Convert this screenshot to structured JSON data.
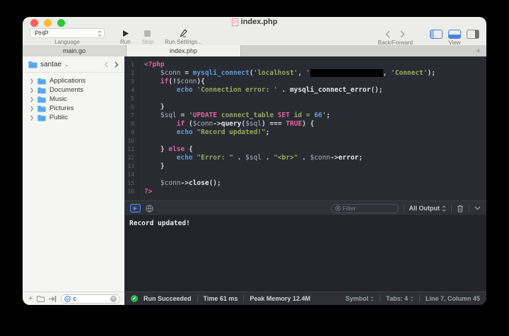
{
  "window": {
    "title": "index.php"
  },
  "toolbar": {
    "language": {
      "value": "PHP",
      "label": "Language"
    },
    "run_label": "Run",
    "stop_label": "Stop",
    "run_settings_label": "Run Settings...",
    "back_forward_label": "Back/Forward",
    "view_label": "View"
  },
  "tabs": {
    "items": [
      {
        "label": "main.go"
      },
      {
        "label": "index.php"
      }
    ],
    "add_label": "+"
  },
  "sidebar": {
    "root_label": "santae",
    "items": [
      {
        "label": "Applications"
      },
      {
        "label": "Documents"
      },
      {
        "label": "Music"
      },
      {
        "label": "Pictures"
      },
      {
        "label": "Public"
      }
    ],
    "footer": {
      "search_value": "c"
    }
  },
  "editor": {
    "lines": [
      {
        "segments": [
          [
            "k",
            "<?php"
          ]
        ]
      },
      {
        "segments": [
          [
            "p",
            "    "
          ],
          [
            "v",
            "$conn"
          ],
          [
            "p",
            " = "
          ],
          [
            "b",
            "mysqli_connect"
          ],
          [
            "p",
            "("
          ],
          [
            "s",
            "'localhost'"
          ],
          [
            "p",
            ", "
          ],
          [
            "s",
            "'"
          ],
          [
            "r",
            "                  "
          ],
          [
            "p",
            ", "
          ],
          [
            "s",
            "'Connect'"
          ],
          [
            "p",
            ");"
          ]
        ]
      },
      {
        "segments": [
          [
            "p",
            "    "
          ],
          [
            "k",
            "if"
          ],
          [
            "p",
            "(!"
          ],
          [
            "v",
            "$conn"
          ],
          [
            "p",
            "){"
          ]
        ]
      },
      {
        "segments": [
          [
            "p",
            "        "
          ],
          [
            "b",
            "echo"
          ],
          [
            "s",
            " 'Connection error: '"
          ],
          [
            "p",
            " . "
          ],
          [
            "w",
            "mysqli_connect_error"
          ],
          [
            "p",
            "();"
          ]
        ]
      },
      {
        "segments": []
      },
      {
        "segments": [
          [
            "p",
            "    }"
          ]
        ]
      },
      {
        "segments": [
          [
            "p",
            "    "
          ],
          [
            "v",
            "$sql"
          ],
          [
            "p",
            " = "
          ],
          [
            "s",
            "'"
          ],
          [
            "k",
            "UPDATE"
          ],
          [
            "s",
            " connect_table "
          ],
          [
            "k",
            "SET"
          ],
          [
            "s",
            " id = "
          ],
          [
            "n",
            "66"
          ],
          [
            "s",
            "'"
          ],
          [
            "p",
            ";"
          ]
        ]
      },
      {
        "segments": [
          [
            "p",
            "        "
          ],
          [
            "k",
            "if"
          ],
          [
            "p",
            " ("
          ],
          [
            "v",
            "$conn"
          ],
          [
            "p",
            "->"
          ],
          [
            "w",
            "query"
          ],
          [
            "p",
            "("
          ],
          [
            "v",
            "$sql"
          ],
          [
            "p",
            ") === "
          ],
          [
            "k",
            "TRUE"
          ],
          [
            "p",
            ") {"
          ]
        ]
      },
      {
        "segments": [
          [
            "p",
            "        "
          ],
          [
            "b",
            "echo"
          ],
          [
            "s",
            " \"Record updated!\""
          ],
          [
            "p",
            ";"
          ]
        ]
      },
      {
        "segments": []
      },
      {
        "segments": [
          [
            "p",
            "    } "
          ],
          [
            "k",
            "else"
          ],
          [
            "p",
            " {"
          ]
        ]
      },
      {
        "segments": [
          [
            "p",
            "        "
          ],
          [
            "b",
            "echo"
          ],
          [
            "s",
            " \"Error: \""
          ],
          [
            "p",
            " . "
          ],
          [
            "v",
            "$sql"
          ],
          [
            "p",
            " . "
          ],
          [
            "s",
            "\"<br>\""
          ],
          [
            "p",
            " . "
          ],
          [
            "v",
            "$conn"
          ],
          [
            "p",
            "->"
          ],
          [
            "w",
            "error"
          ],
          [
            "p",
            ";"
          ]
        ]
      },
      {
        "segments": [
          [
            "p",
            "    }"
          ]
        ]
      },
      {
        "segments": []
      },
      {
        "segments": [
          [
            "p",
            "    "
          ],
          [
            "v",
            "$conn"
          ],
          [
            "p",
            "->"
          ],
          [
            "w",
            "close"
          ],
          [
            "p",
            "();"
          ]
        ]
      },
      {
        "segments": [
          [
            "k",
            "?>"
          ]
        ]
      }
    ]
  },
  "console": {
    "filter_placeholder": "Filter",
    "output_select_label": "All Output",
    "output_text": "Record updated!"
  },
  "statusbar": {
    "status_label": "Run Succeeded",
    "time_label": "Time 61 ms",
    "memory_label": "Peak Memory 12.4M",
    "symbol_label": "Symbol",
    "tabs_label": "Tabs: 4",
    "position_label": "Line 7, Column 45"
  },
  "colors": {
    "traffic_red": "#ff5f57",
    "traffic_yellow": "#febc2e",
    "traffic_green": "#28c840",
    "accent_blue": "#4f8ef7",
    "success_green": "#2db14e",
    "syntax_keyword": "#e2609f",
    "syntax_function": "#5c9ed9",
    "syntax_string": "#95aa5f",
    "syntax_variable": "#aab2bd",
    "editor_bg": "#282b31"
  }
}
